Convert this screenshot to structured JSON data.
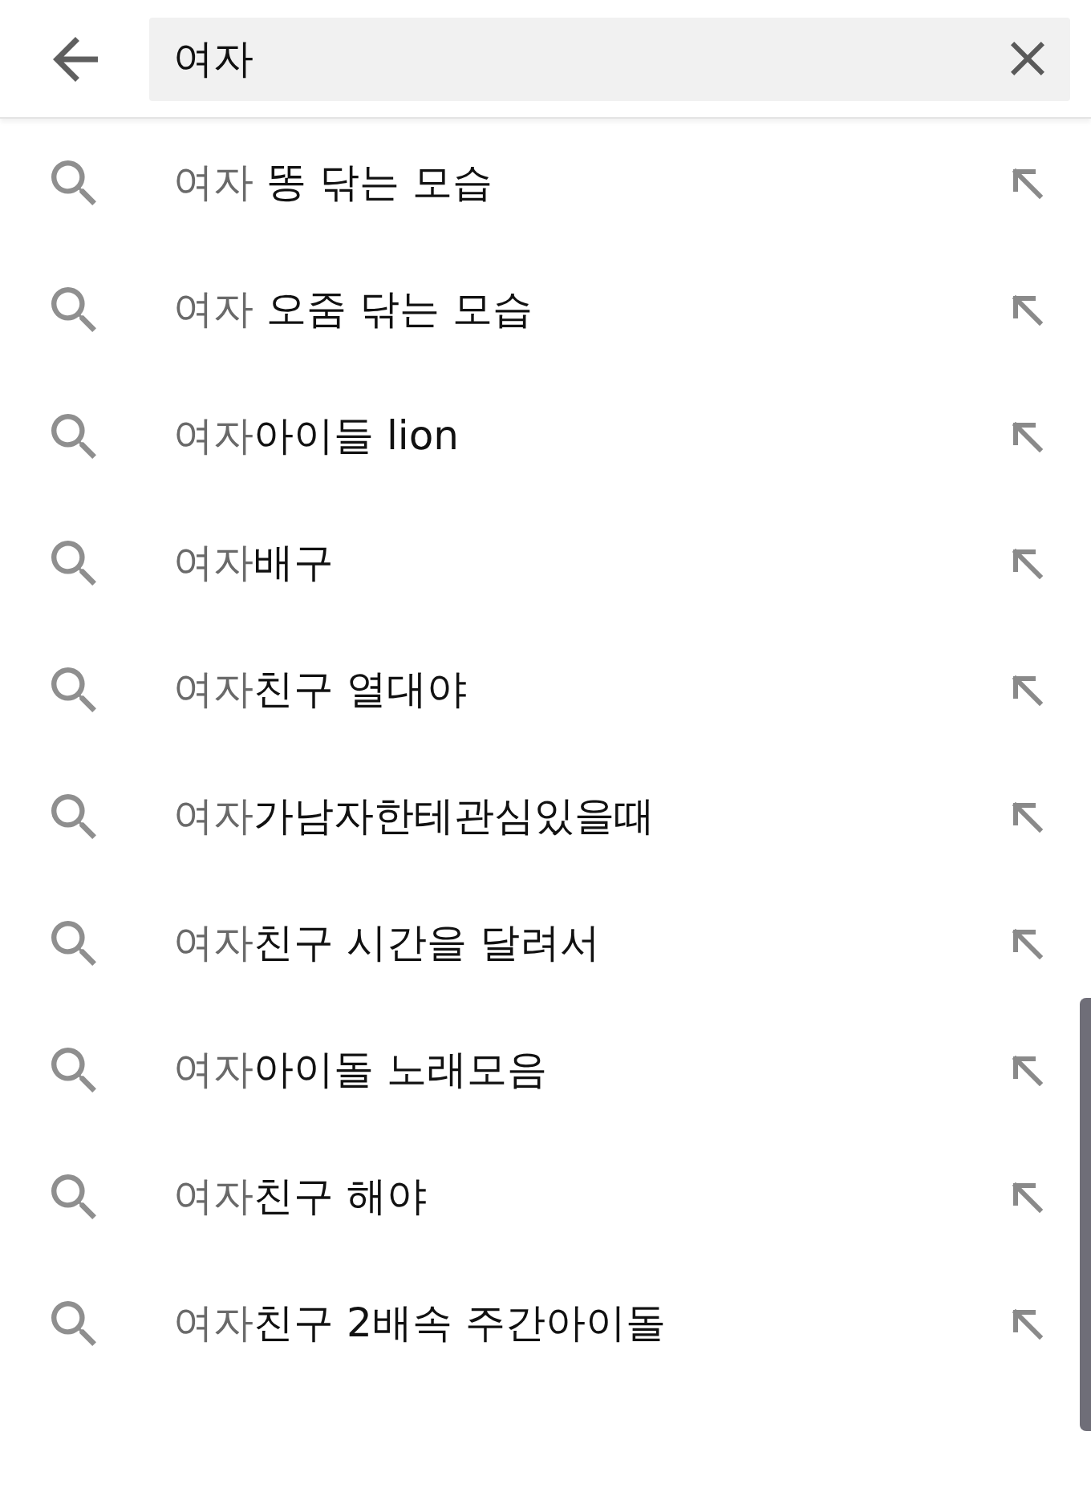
{
  "search": {
    "value": "여자"
  },
  "suggestions": [
    {
      "text": "여자 **똥 닦는 모습**"
    },
    {
      "text": "여자 **오줌 닦는 모습**"
    },
    {
      "text": "여자**아이들 lion**"
    },
    {
      "text": "여자**배구**"
    },
    {
      "text": "여자**친구 열대야**"
    },
    {
      "text": "여자**가남자한테관심있을때**"
    },
    {
      "text": "여자**친구 시간을 달려서**"
    },
    {
      "text": "여자**아이돌 노래모음**"
    },
    {
      "text": "여자**친구 해야**"
    },
    {
      "text": "여자**친구 2배속 주간아이돌**"
    }
  ]
}
